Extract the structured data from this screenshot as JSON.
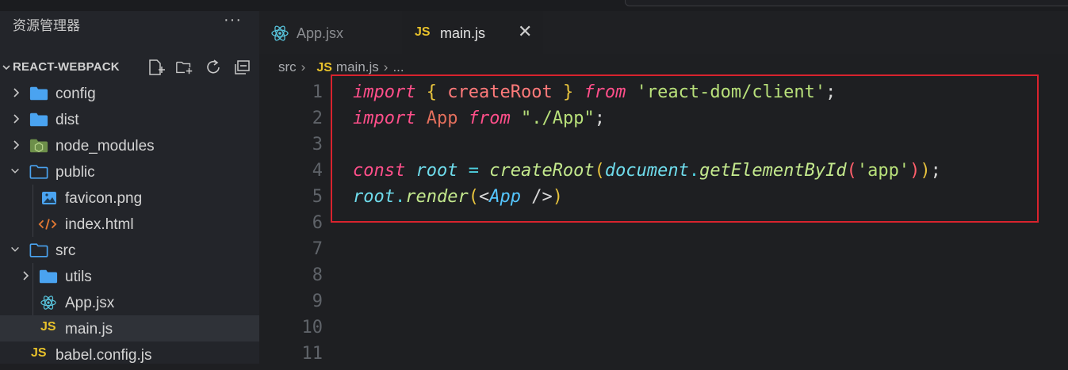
{
  "explorer": {
    "title": "资源管理器",
    "more": "···",
    "project": "REACT-WEBPACK",
    "items": [
      {
        "label": "config",
        "type": "folder",
        "expanded": false,
        "depth": 0
      },
      {
        "label": "dist",
        "type": "folder",
        "expanded": false,
        "depth": 0
      },
      {
        "label": "node_modules",
        "type": "node-folder",
        "expanded": false,
        "depth": 0
      },
      {
        "label": "public",
        "type": "folder",
        "expanded": true,
        "depth": 0
      },
      {
        "label": "favicon.png",
        "type": "image",
        "depth": 1
      },
      {
        "label": "index.html",
        "type": "html",
        "depth": 1
      },
      {
        "label": "src",
        "type": "folder",
        "expanded": true,
        "depth": 0
      },
      {
        "label": "utils",
        "type": "folder",
        "expanded": false,
        "depth": 1
      },
      {
        "label": "App.jsx",
        "type": "react",
        "depth": 1
      },
      {
        "label": "main.js",
        "type": "js",
        "depth": 1,
        "selected": true
      },
      {
        "label": "babel.config.js",
        "type": "js",
        "depth": 0
      }
    ]
  },
  "tabs": [
    {
      "label": "App.jsx",
      "icon": "react-icon",
      "active": false
    },
    {
      "label": "main.js",
      "icon": "js-icon",
      "active": true,
      "close": "✕"
    }
  ],
  "breadcrumb": {
    "folder": "src",
    "file_icon": "JS",
    "file": "main.js",
    "more": "..."
  },
  "line_numbers": [
    "1",
    "2",
    "3",
    "4",
    "5",
    "6",
    "7",
    "8",
    "9",
    "10",
    "11"
  ],
  "code": {
    "l1": {
      "a": "import",
      "b": "{",
      "c": "createRoot",
      "d": "}",
      "e": "from",
      "f": "'react-dom/client'",
      "g": ";"
    },
    "l2": {
      "a": "import",
      "b": "App",
      "c": "from",
      "d": "\"./App\"",
      "e": ";"
    },
    "l4": {
      "a": "const",
      "b": "root",
      "c": "=",
      "d": "createRoot",
      "e": "(",
      "f": "document",
      "g": ".",
      "h": "getElementById",
      "i": "(",
      "j": "'app'",
      "k": ")",
      "l": ")",
      "m": ";"
    },
    "l5": {
      "a": "root",
      "b": ".",
      "c": "render",
      "d": "(",
      "e": "<",
      "f": "App",
      "g": "/>",
      "h": ")"
    }
  },
  "colors": {
    "highlight_border": "#d9232e",
    "js_badge": "#e8c22b",
    "folder": "#4aa3f0"
  }
}
